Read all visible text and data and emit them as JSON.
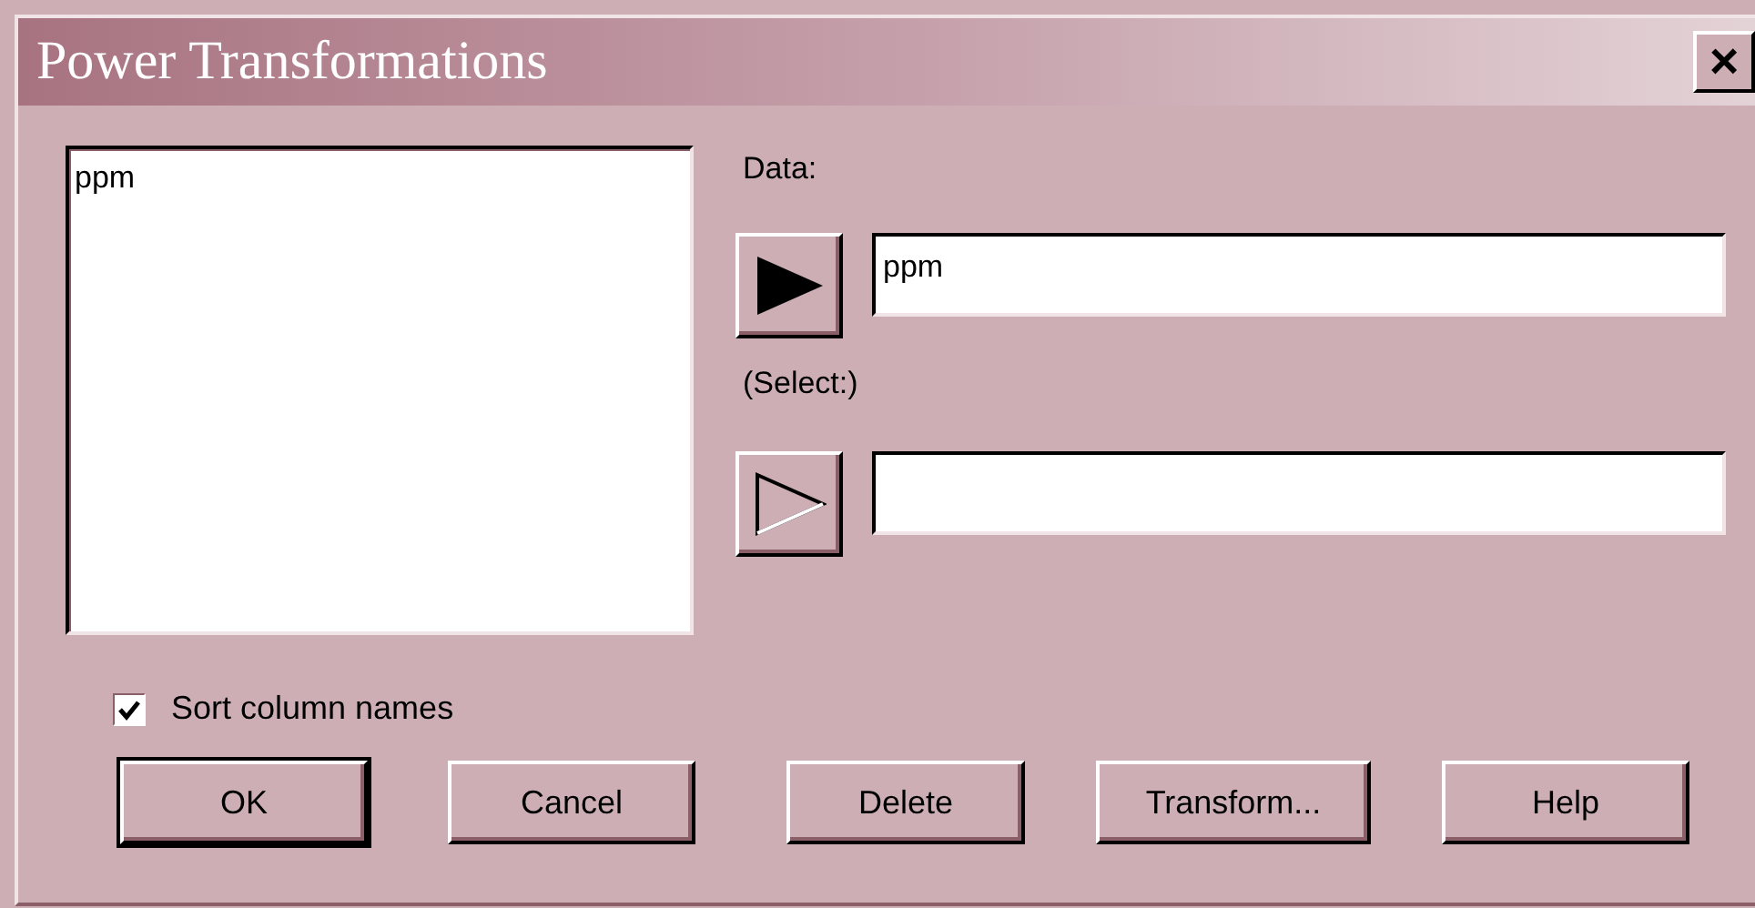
{
  "window": {
    "title": "Power Transformations",
    "close": "×"
  },
  "column_list": {
    "items": [
      "ppm"
    ]
  },
  "fields": [
    {
      "label": "Data:",
      "kind": "filled",
      "value": "ppm"
    },
    {
      "label": "(Select:)",
      "kind": "outline"
    }
  ],
  "sort_columns": {
    "label": "Sort column names",
    "checked": true
  },
  "buttons": [
    {
      "label": "OK",
      "default": true
    },
    {
      "label": "Cancel",
      "default": false
    },
    {
      "label": "Delete",
      "default": false
    },
    {
      "label": "Transform...",
      "default": false
    },
    {
      "label": "Help",
      "default": false
    }
  ]
}
